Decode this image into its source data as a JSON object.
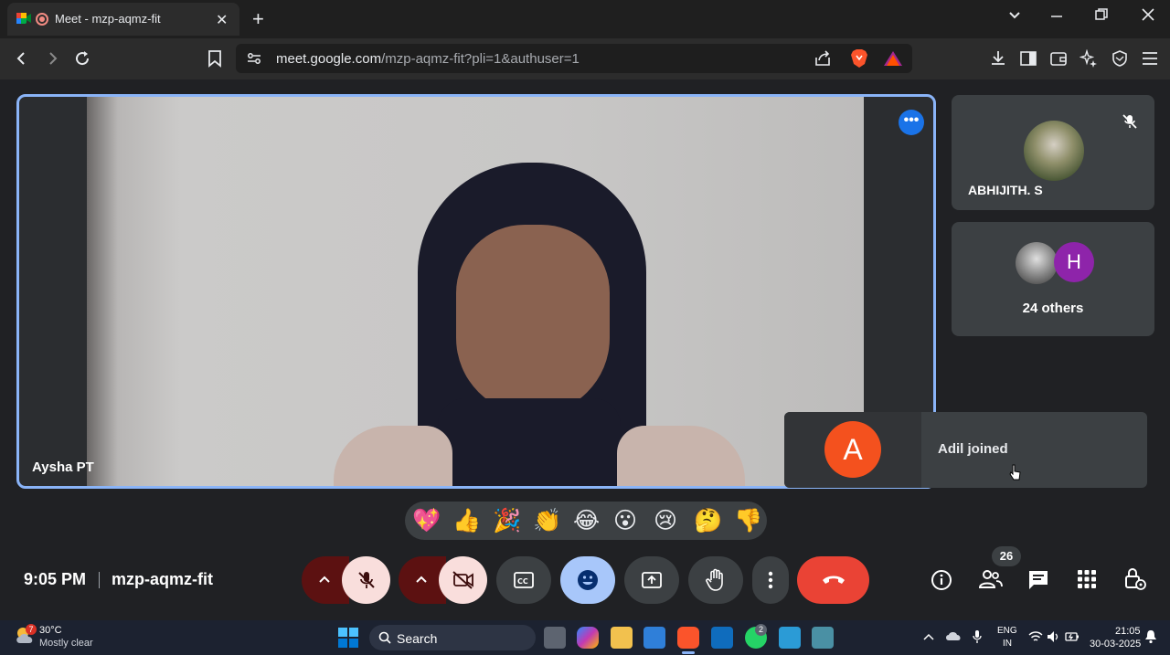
{
  "browser": {
    "tab_title": "Meet - mzp-aqmz-fit",
    "url_host": "meet.google.com",
    "url_path": "/mzp-aqmz-fit?pli=1&authuser=1"
  },
  "meet": {
    "main_speaker_name": "Aysha PT",
    "side_tiles": [
      {
        "name": "ABHIJITH. S"
      },
      {
        "label": "24 others",
        "avatar_letter": "H"
      }
    ],
    "toast": {
      "avatar_letter": "A",
      "text": "Adil joined"
    },
    "reactions": [
      "💖",
      "👍",
      "🎉",
      "👏",
      "😂",
      "😮",
      "😢",
      "🤔",
      "👎"
    ],
    "time": "9:05 PM",
    "meeting_code": "mzp-aqmz-fit",
    "participant_count": "26",
    "colors": {
      "accent_blue": "#8ab4f8",
      "end_call_red": "#ea4335",
      "avatar_a": "#f4511e",
      "avatar_h": "#8e24aa"
    }
  },
  "taskbar": {
    "weather_temp": "30°C",
    "weather_desc": "Mostly clear",
    "weather_badge": "7",
    "search_label": "Search",
    "whatsapp_badge": "2",
    "lang_top": "ENG",
    "lang_bottom": "IN",
    "clock_time": "21:05",
    "clock_date": "30-03-2025"
  }
}
